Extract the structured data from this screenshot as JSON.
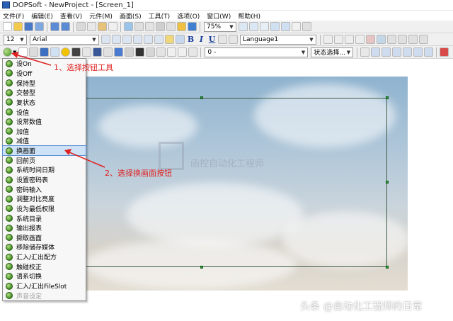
{
  "window": {
    "title": "DOPSoft - NewProject - [Screen_1]"
  },
  "menubar": [
    "文件(F)",
    "编辑(E)",
    "查看(V)",
    "元件(M)",
    "画面(S)",
    "工具(T)",
    "选项(O)",
    "窗口(W)",
    "帮助(H)"
  ],
  "toolbar1": {
    "zoom": "75%"
  },
  "toolbar2": {
    "font_size": "12",
    "font_name": "Arial",
    "bold": "B",
    "italic": "I",
    "underline": "U",
    "language": "Language1"
  },
  "toolbar3": {
    "value_combo": "0 -",
    "state_label": "状态选择..."
  },
  "button_menu": {
    "items": [
      "设On",
      "设Off",
      "保持型",
      "交替型",
      "复状态",
      "设值",
      "设常数值",
      "加值",
      "减值",
      "换画面",
      "回前页",
      "系统时间日期",
      "设置密码表",
      "密码输入",
      "调整对比亮度",
      "设为最低权限",
      "系统目录",
      "输出报表",
      "撷取画面",
      "移除储存媒体",
      "汇入/汇出配方",
      "触碰校正",
      "语系切换",
      "汇入/汇出FileSlot",
      "声音设定"
    ],
    "highlighted_index": 9,
    "disabled_index": 24
  },
  "canvas": {
    "watermark_text": "函控自动化工程师"
  },
  "annotations": {
    "step1": "1、选择按钮工具",
    "step2": "2、选择换画面按钮",
    "arrow_color": "#e02020"
  },
  "footer_watermark": "头条 @自动化工程师的日常"
}
